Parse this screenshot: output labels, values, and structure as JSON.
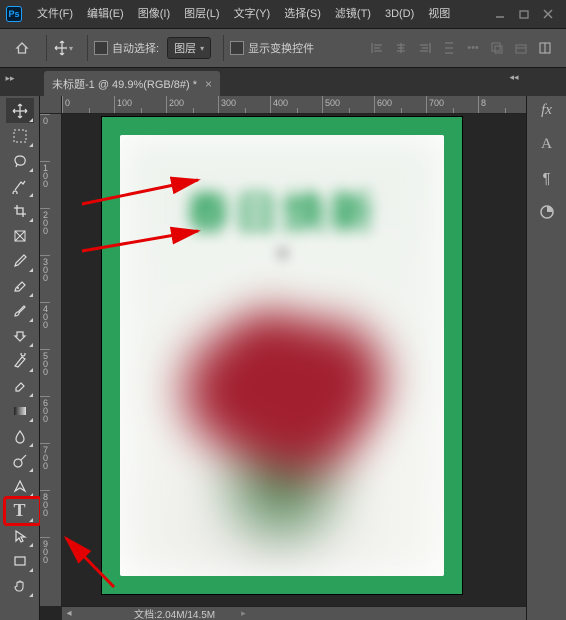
{
  "menu": {
    "file": "文件(F)",
    "edit": "编辑(E)",
    "image": "图像(I)",
    "layer": "图层(L)",
    "type": "文字(Y)",
    "select": "选择(S)",
    "filter": "滤镜(T)",
    "threeD": "3D(D)",
    "view": "视图"
  },
  "options": {
    "auto_select_label": "自动选择:",
    "dropdown_value": "图层",
    "show_transform_label": "显示变换控件"
  },
  "tab": {
    "title": "未标题-1 @ 49.9%(RGB/8#) *"
  },
  "ruler_h": [
    "0",
    "100",
    "200",
    "300",
    "400",
    "500",
    "600",
    "700",
    "8"
  ],
  "ruler_v": [
    "0",
    "100",
    "200",
    "300",
    "400",
    "500",
    "600",
    "700",
    "800",
    "900"
  ],
  "document": {
    "title_text": "春日焕新",
    "subtitle_text": "领"
  },
  "status": {
    "doc_info": "文档:2.04M/14.5M"
  }
}
